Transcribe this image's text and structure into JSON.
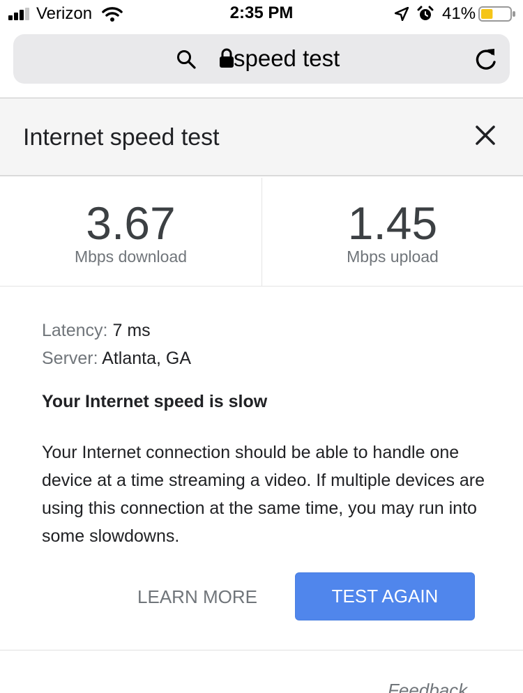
{
  "status_bar": {
    "carrier": "Verizon",
    "time": "2:35 PM",
    "battery_percent": "41%",
    "battery_level": 0.41,
    "signal_bars": 3,
    "icons": [
      "signal-icon",
      "wifi-icon",
      "location-arrow-icon",
      "alarm-icon",
      "battery-icon"
    ],
    "battery_color": "#f5c518"
  },
  "address_bar": {
    "query": "speed test",
    "icons": [
      "search-icon",
      "lock-icon",
      "reload-icon"
    ]
  },
  "card": {
    "title": "Internet speed test",
    "close_icon": "close-icon"
  },
  "metrics": {
    "download": {
      "value": "3.67",
      "label": "Mbps download"
    },
    "upload": {
      "value": "1.45",
      "label": "Mbps upload"
    }
  },
  "details": {
    "latency_label": "Latency:",
    "latency_value": "7 ms",
    "server_label": "Server:",
    "server_value": "Atlanta, GA"
  },
  "result": {
    "headline": "Your Internet speed is slow",
    "description": "Your Internet connection should be able to handle one device at a time streaming a video. If multiple devices are using this connection at the same time, you may run into some slowdowns."
  },
  "actions": {
    "learn_more": "LEARN MORE",
    "test_again": "TEST AGAIN",
    "accent_color": "#5086ec"
  },
  "footer": {
    "feedback": "Feedback"
  }
}
